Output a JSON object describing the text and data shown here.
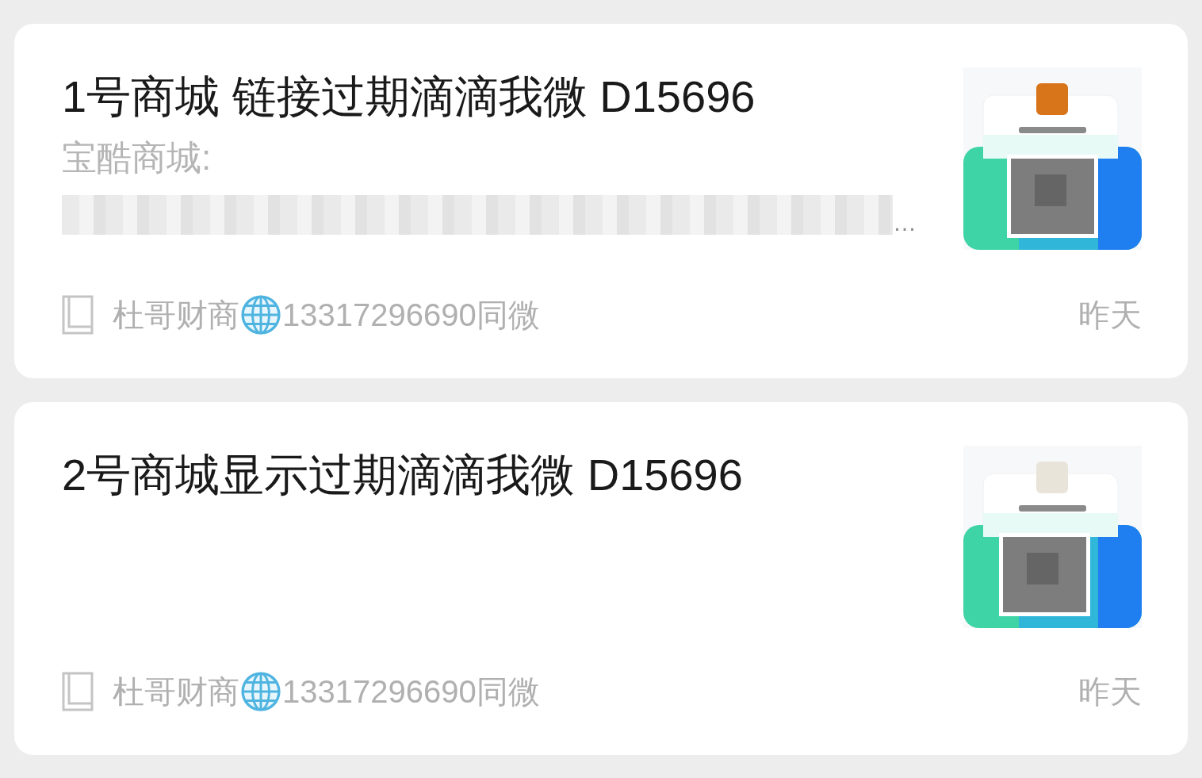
{
  "articles": [
    {
      "title": "1号商城 链接过期滴滴我微 D15696",
      "summary": "宝酷商城:",
      "summary_blurred": true,
      "summary_tail": "…",
      "source": "杜哥财商",
      "source_suffix": "13317296690同微",
      "time": "昨天"
    },
    {
      "title": "2号商城显示过期滴滴我微 D15696",
      "source": "杜哥财商",
      "source_suffix": "13317296690同微",
      "time": "昨天"
    }
  ]
}
